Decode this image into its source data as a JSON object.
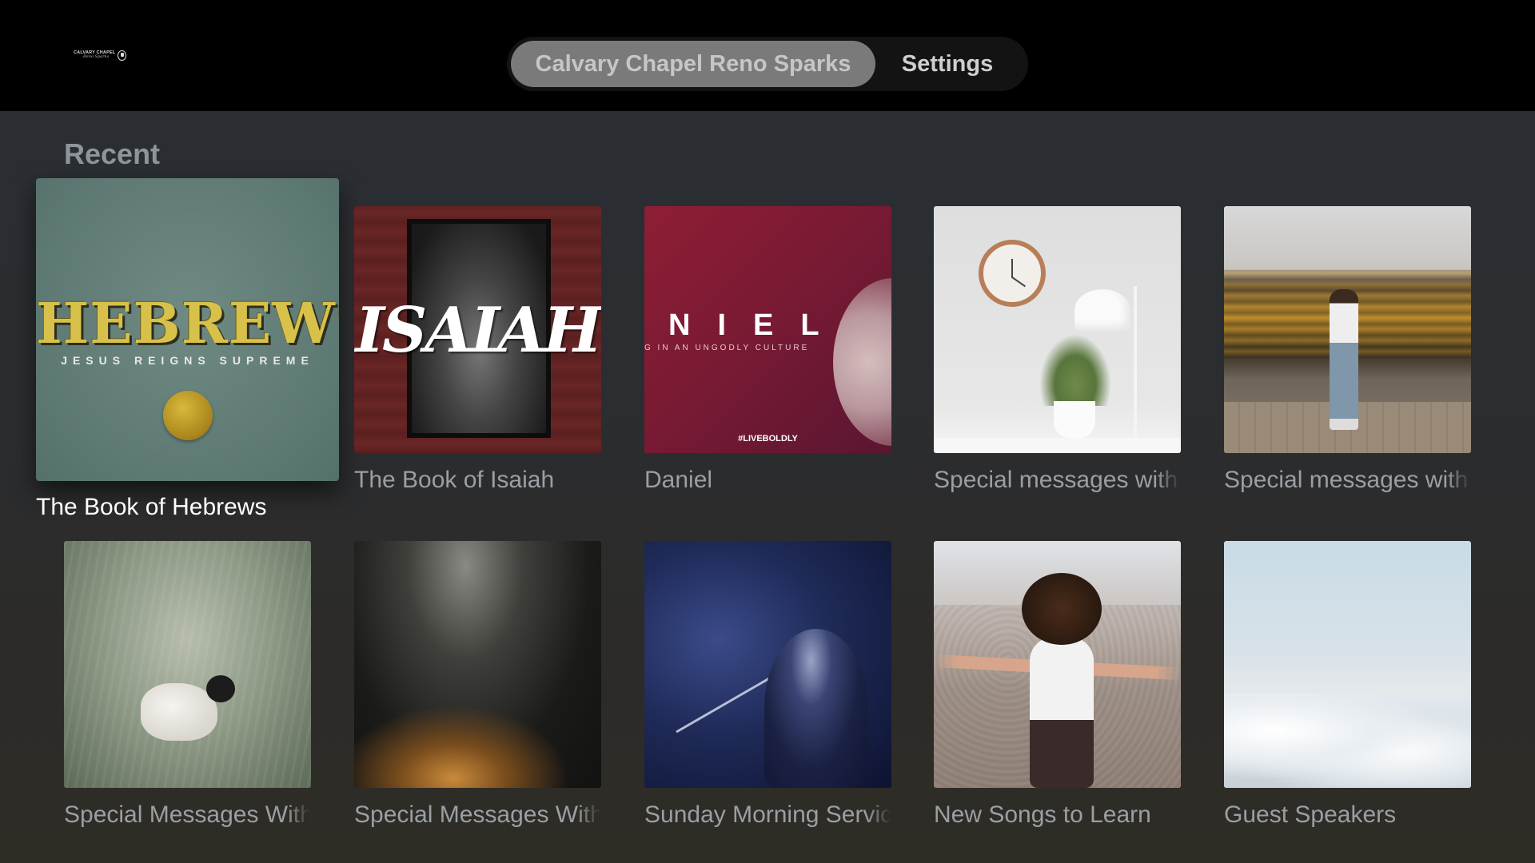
{
  "logo": {
    "line1": "CALVARY CHAPEL",
    "line2": "Reno Sparks",
    "icon": "chapel-seal-icon"
  },
  "tabs": [
    {
      "label": "Calvary Chapel Reno Sparks",
      "active": true
    },
    {
      "label": "Settings",
      "active": false
    }
  ],
  "section": {
    "title": "Recent"
  },
  "tiles": [
    {
      "label": "The Book of Hebrews",
      "art_title": "HEBREWS",
      "art_subtitle": "JESUS REIGNS SUPREME",
      "focused": true
    },
    {
      "label": "The Book of Isaiah",
      "art_title": "ISAIAH"
    },
    {
      "label": "Daniel",
      "art_title": "NIEL",
      "art_subtitle": "G IN AN UNGODLY CULTURE",
      "art_tag": "#LIVEBOLDLY"
    },
    {
      "label": "Special messages with"
    },
    {
      "label": "Special messages with"
    },
    {
      "label": "Special Messages With"
    },
    {
      "label": "Special Messages With"
    },
    {
      "label": "Sunday Morning Servic"
    },
    {
      "label": "New Songs to Learn"
    },
    {
      "label": "Guest Speakers"
    }
  ]
}
